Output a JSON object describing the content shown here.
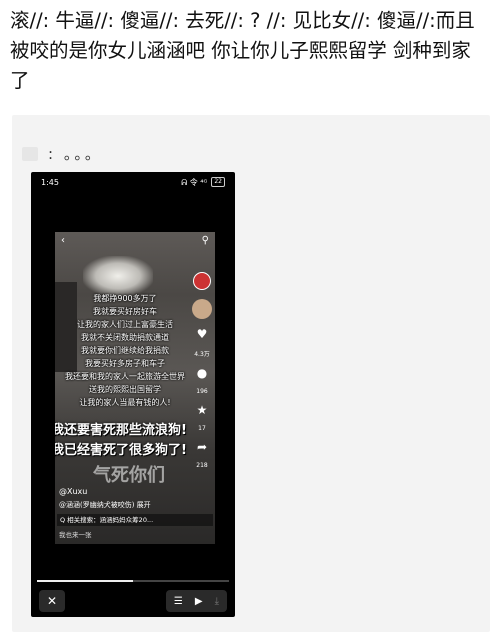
{
  "post": {
    "text": "滚//: 牛逼//: 傻逼//: 去死//: ? //: 见比女//: 傻逼//:而且被咬的是你女儿涵涵吧 你让你儿子熙熙留学 剑种到家了"
  },
  "quote": {
    "text": ": 。。。"
  },
  "phone": {
    "status_time": "1:45",
    "status_right": "ᕱ 令 ⁴ᴳ",
    "battery": "22",
    "video": {
      "back_icon": "‹",
      "search_icon": "⚲",
      "lines": [
        "我都挣900多万了",
        "我就要买好房好车",
        "让我的家人们过上富豪生活",
        "我就不关闭数助捐款通道",
        "我就要你们继续给我捐款",
        "我要买好多房子和车子",
        "我还要和我的家人一起旅游全世界",
        "送我的熙熙出国留学",
        "让我的家人当最有钱的人!"
      ],
      "big_line_1": "我还要害死那些流浪狗!",
      "big_line_2": "我已经害死了很多狗了!",
      "angry_text": "气死你们",
      "username": "@Xuxu",
      "caption": "@涵涵(罗幽纳犬被咬伤) 展开",
      "search_bar": "Q 相关搜索：涵涵妈妈众筹20...",
      "comment_hint": "我也来一张",
      "side_counts": [
        "4.3万",
        "196",
        "17",
        "218"
      ]
    },
    "progress": 0.5,
    "controls": {
      "close": "✕",
      "list": "☰",
      "play": "▶",
      "download": "⤓"
    }
  }
}
